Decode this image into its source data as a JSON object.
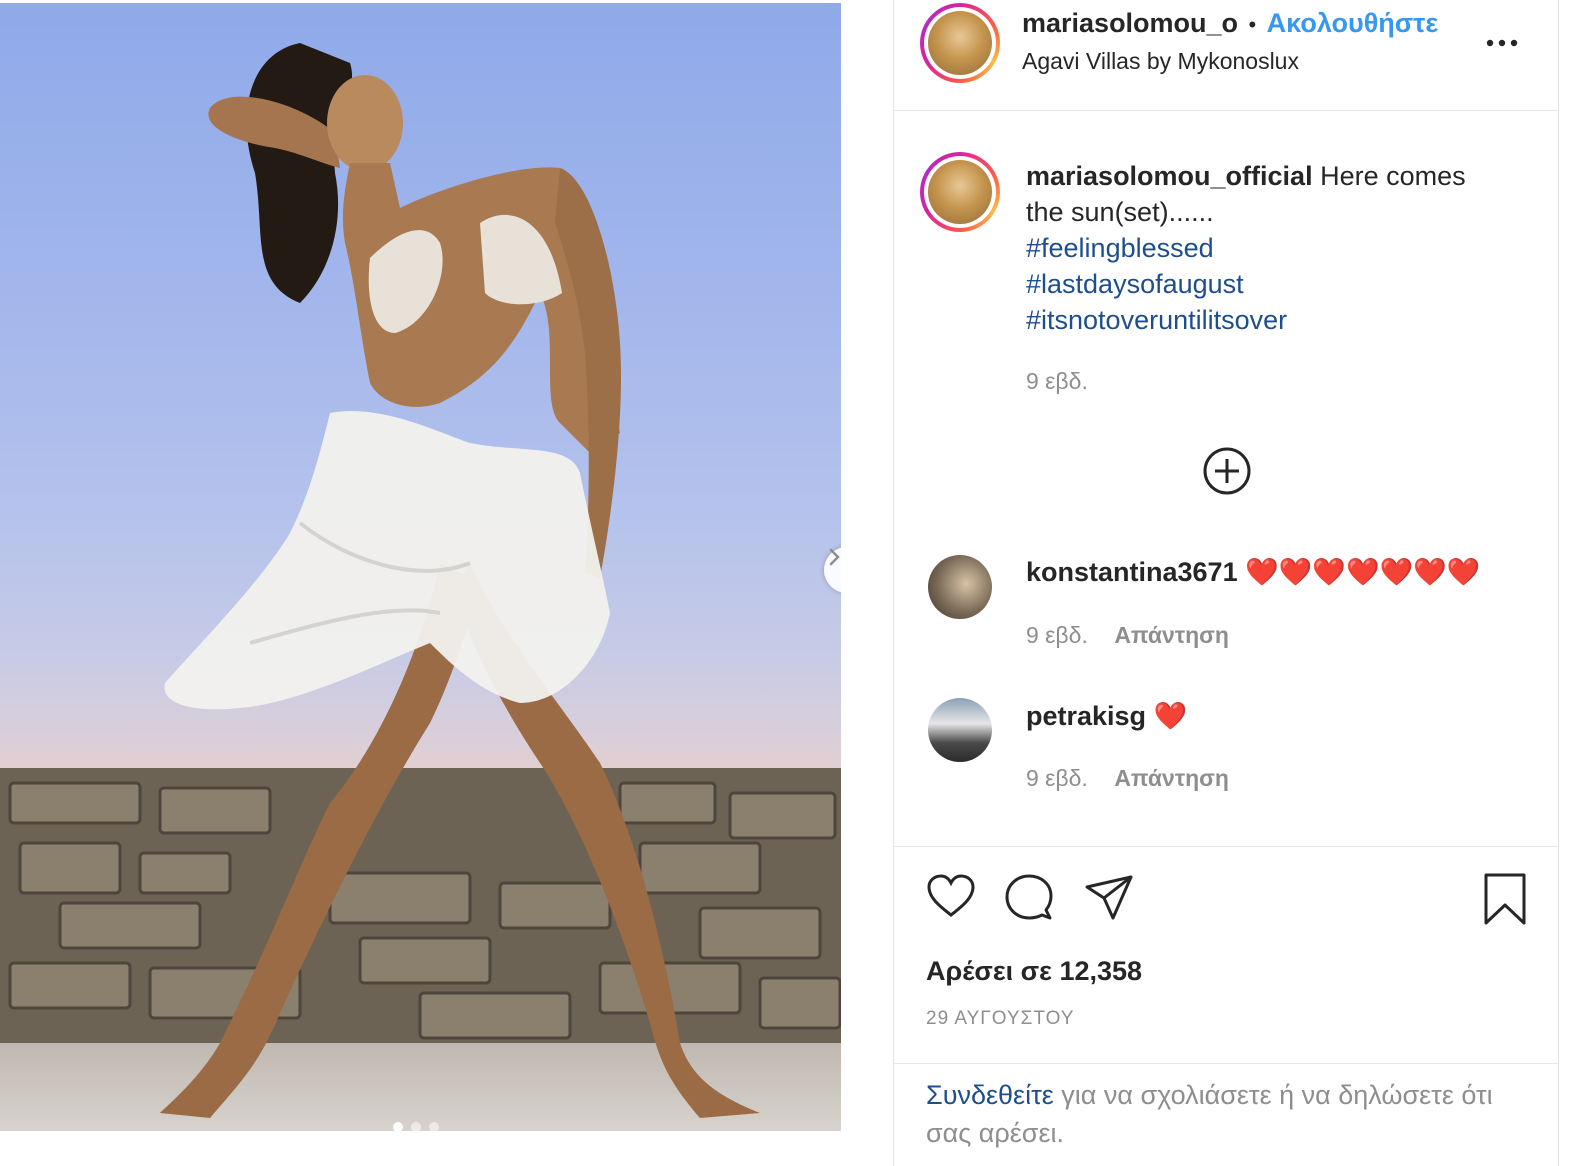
{
  "header": {
    "username": "mariasolomou_o",
    "separator": "•",
    "follow_label": "Ακολουθήστε",
    "location": "Agavi Villas by Mykonoslux",
    "more_icon": "ellipsis-icon"
  },
  "caption": {
    "username": "mariasolomou_official",
    "text": "Here comes the sun(set)......",
    "hashtags": [
      "#feelingblessed",
      "#lastdaysofaugust",
      "#itsnotoveruntilitsover"
    ],
    "time": "9 εβδ."
  },
  "load_more_icon": "plus-circle-icon",
  "comments": [
    {
      "username": "konstantina3671",
      "text": "❤️❤️❤️❤️❤️❤️❤️",
      "time": "9 εβδ.",
      "reply_label": "Απάντηση"
    },
    {
      "username": "petrakisg",
      "text": "❤️",
      "time": "9 εβδ.",
      "reply_label": "Απάντηση"
    }
  ],
  "actions": {
    "like_icon": "heart-icon",
    "comment_icon": "comment-icon",
    "share_icon": "paper-plane-icon",
    "save_icon": "bookmark-icon"
  },
  "likes_text": "Αρέσει σε 12,358",
  "date": "29 ΑΥΓΟΥΣΤΟΥ",
  "login": {
    "link_label": "Συνδεθείτε",
    "rest": " για να σχολιάσετε ή να δηλώσετε ότι σας αρέσει."
  },
  "carousel": {
    "total": 3,
    "current": 1
  },
  "colors": {
    "link_blue": "#3897f0",
    "hashtag_blue": "#1f4e8d",
    "muted": "#8e8e8e",
    "text": "#262626"
  }
}
